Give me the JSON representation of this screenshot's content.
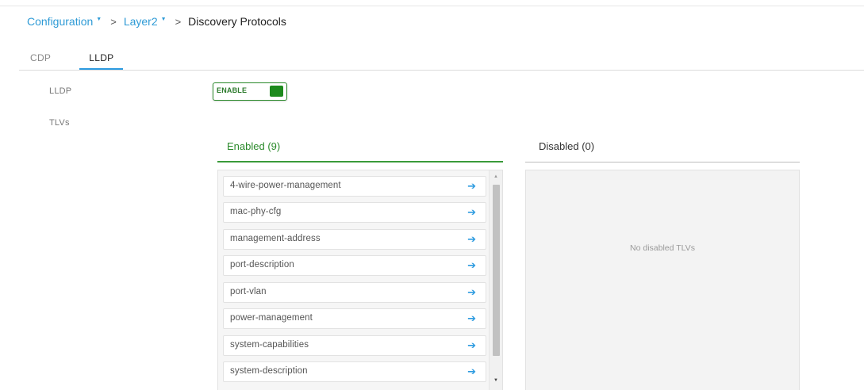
{
  "breadcrumb": {
    "items": [
      {
        "label": "Configuration",
        "caret": "▼"
      },
      {
        "label": "Layer2",
        "caret": "▼"
      }
    ],
    "separator": ">",
    "current": "Discovery Protocols"
  },
  "tabs": [
    {
      "label": "CDP",
      "active": false
    },
    {
      "label": "LLDP",
      "active": true
    }
  ],
  "form": {
    "lldp_label": "LLDP",
    "tlvs_label": "TLVs",
    "toggle": {
      "text": "ENABLE",
      "state": "on"
    }
  },
  "enabled": {
    "title": "Enabled (9)",
    "items": [
      "4-wire-power-management",
      "mac-phy-cfg",
      "management-address",
      "port-description",
      "port-vlan",
      "power-management",
      "system-capabilities",
      "system-description"
    ],
    "arrow": "➔"
  },
  "disabled": {
    "title": "Disabled (0)",
    "empty_text": "No disabled TLVs"
  },
  "colors": {
    "accent_blue": "#2d9be0",
    "enabled_green": "#2b8a2b",
    "toggle_knob": "#1c8a1c"
  }
}
